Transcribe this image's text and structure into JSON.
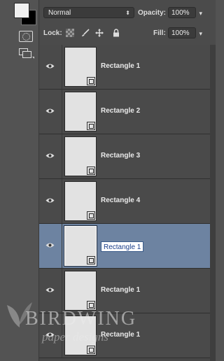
{
  "toolbar": {
    "foreground_color": "#f0f0f0",
    "background_color": "#000000"
  },
  "options": {
    "blend_mode": "Normal",
    "opacity_label": "Opacity:",
    "opacity_value": "100%",
    "lock_label": "Lock:",
    "fill_label": "Fill:",
    "fill_value": "100%"
  },
  "layers": [
    {
      "name": "Rectangle 1",
      "selected": false
    },
    {
      "name": "Rectangle 2",
      "selected": false
    },
    {
      "name": "Rectangle 3",
      "selected": false
    },
    {
      "name": "Rectangle 4",
      "selected": false
    },
    {
      "name": "Rectangle 1",
      "selected": true,
      "renaming": true
    },
    {
      "name": "Rectangle 1",
      "selected": false
    },
    {
      "name": "Rectangle 1",
      "selected": false
    }
  ],
  "watermark": {
    "title": "BIRDWING",
    "subtitle": "paper designs"
  },
  "colors": {
    "selection": "#6d83a1",
    "panel": "#474747"
  }
}
